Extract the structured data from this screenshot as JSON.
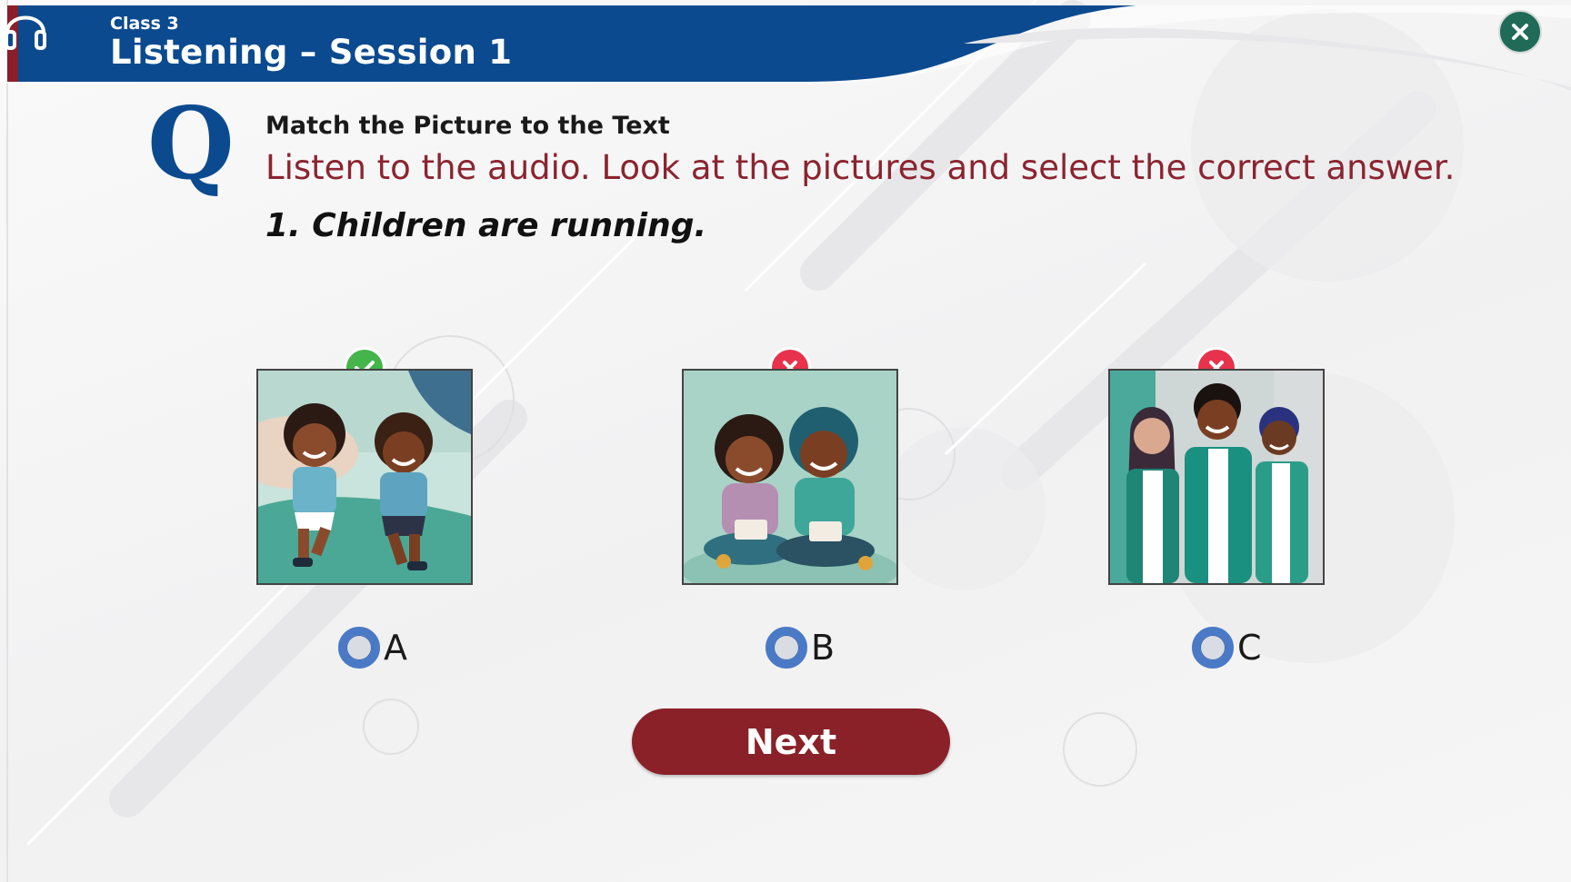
{
  "header": {
    "class_label": "Class 3",
    "title": "Listening – Session 1",
    "icon": "headphones-icon",
    "color": "#0b4a8f"
  },
  "close": {
    "icon": "close-icon",
    "color": "#1f6b57"
  },
  "question": {
    "marker": "Q",
    "task_title": "Match the Picture to the Text",
    "instruction": "Listen to the audio. Look at the pictures and select the correct answer.",
    "prompt": "1. Children are running."
  },
  "options": [
    {
      "label": "A",
      "picture": "two children running",
      "status": "correct"
    },
    {
      "label": "B",
      "picture": "two children sitting and reading",
      "status": "wrong"
    },
    {
      "label": "C",
      "picture": "three teenagers standing",
      "status": "wrong"
    }
  ],
  "next_label": "Next",
  "colors": {
    "correct": "#43b54a",
    "wrong": "#e8324b",
    "accent": "#8b2430",
    "radio": "#4a79c6"
  }
}
